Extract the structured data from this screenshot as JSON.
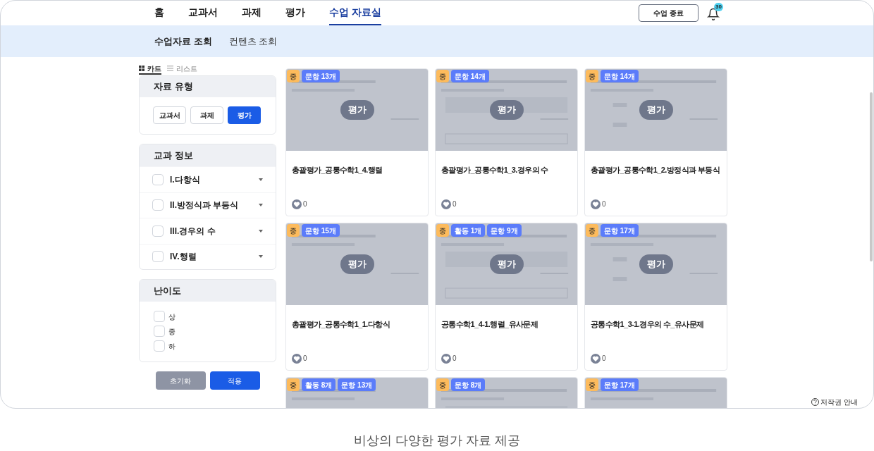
{
  "nav": {
    "tabs": [
      {
        "label": "홈",
        "selected": false
      },
      {
        "label": "교과서",
        "selected": false
      },
      {
        "label": "과제",
        "selected": false
      },
      {
        "label": "평가",
        "selected": false
      },
      {
        "label": "수업 자료실",
        "selected": true
      }
    ],
    "end_button": "수업 종료",
    "notification_count": "30"
  },
  "subnav": [
    {
      "label": "수업자료 조회",
      "selected": true
    },
    {
      "label": "컨텐츠 조회",
      "selected": false
    }
  ],
  "view_toggle": [
    {
      "label": "카드",
      "kind": "grid",
      "selected": true
    },
    {
      "label": "리스트",
      "kind": "list",
      "selected": false
    }
  ],
  "filters": {
    "type": {
      "title": "자료 유형",
      "options": [
        {
          "label": "교과서",
          "selected": false
        },
        {
          "label": "과제",
          "selected": false
        },
        {
          "label": "평가",
          "selected": true
        }
      ]
    },
    "subject": {
      "title": "교과 정보",
      "items": [
        {
          "label": "I.다항식",
          "checked": false
        },
        {
          "label": "II.방정식과 부등식",
          "checked": false
        },
        {
          "label": "III.경우의 수",
          "checked": false
        },
        {
          "label": "IV.행렬",
          "checked": false
        }
      ]
    },
    "difficulty": {
      "title": "난이도",
      "items": [
        {
          "label": "상",
          "checked": false
        },
        {
          "label": "중",
          "checked": false
        },
        {
          "label": "하",
          "checked": false
        }
      ]
    },
    "buttons": [
      {
        "label": "초기화",
        "kind": "reset"
      },
      {
        "label": "적용",
        "kind": "apply"
      }
    ]
  },
  "cards": [
    {
      "level": "중",
      "tags": [
        "문항 13개"
      ],
      "overlay": "평가",
      "title": "총괄평가_공통수학1_4.행렬",
      "likes": "0"
    },
    {
      "level": "중",
      "tags": [
        "문항 14개"
      ],
      "overlay": "평가",
      "title": "총괄평가_공통수학1_3.경우의 수",
      "likes": "0"
    },
    {
      "level": "중",
      "tags": [
        "문항 14개"
      ],
      "overlay": "평가",
      "title": "총괄평가_공통수학1_2.방정식과 부등식",
      "likes": "0"
    },
    {
      "level": "중",
      "tags": [
        "문항 15개"
      ],
      "overlay": "평가",
      "title": "총괄평가_공통수학1_1.다항식",
      "likes": "0"
    },
    {
      "level": "중",
      "tags": [
        "활동 1개",
        "문항 9개"
      ],
      "overlay": "평가",
      "title": "공통수학1_4-1.행렬_유사문제",
      "likes": "0"
    },
    {
      "level": "중",
      "tags": [
        "문항 17개"
      ],
      "overlay": "평가",
      "title": "공통수학1_3-1.경우의 수_유사문제",
      "likes": "0"
    },
    {
      "level": "중",
      "tags": [
        "활동 8개",
        "문항 13개"
      ]
    },
    {
      "level": "중",
      "tags": [
        "문항 8개"
      ]
    },
    {
      "level": "중",
      "tags": [
        "문항 17개"
      ]
    }
  ],
  "copyright": "저작권 안내",
  "caption": "비상의 다양한 평가 자료 제공"
}
